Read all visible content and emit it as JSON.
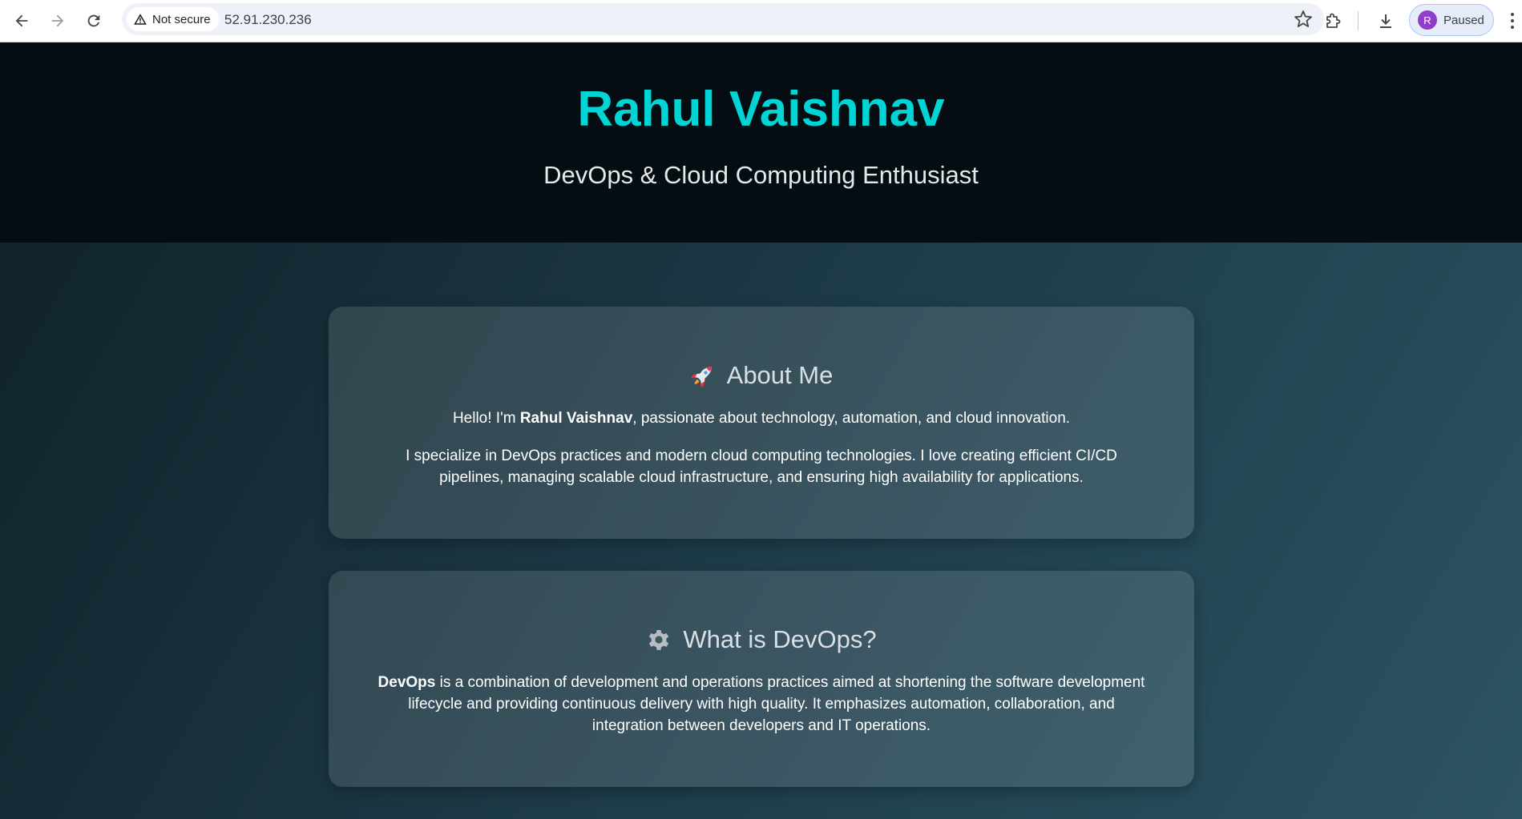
{
  "browser": {
    "security_label": "Not secure",
    "url": "52.91.230.236",
    "profile_initial": "R",
    "profile_status": "Paused"
  },
  "hero": {
    "title": "Rahul Vaishnav",
    "subtitle": "DevOps & Cloud Computing Enthusiast"
  },
  "about": {
    "icon": "rocket-icon",
    "heading": "About Me",
    "p1_prefix": "Hello! I'm ",
    "p1_name": "Rahul Vaishnav",
    "p1_suffix": ", passionate about technology, automation, and cloud innovation.",
    "p2": "I specialize in DevOps practices and modern cloud computing technologies. I love creating efficient CI/CD pipelines, managing scalable cloud infrastructure, and ensuring high availability for applications."
  },
  "devops": {
    "icon": "gear-icon",
    "heading": "What is DevOps?",
    "p1_term": "DevOps",
    "p1_rest": " is a combination of development and operations practices aimed at shortening the software development lifecycle and providing continuous delivery with high quality. It emphasizes automation, collaboration, and integration between developers and IT operations."
  },
  "colors": {
    "accent": "#00d4d4",
    "hero_bg": "#060d12",
    "page_gradient_start": "#0f2027",
    "page_gradient_end": "#2c5364"
  }
}
